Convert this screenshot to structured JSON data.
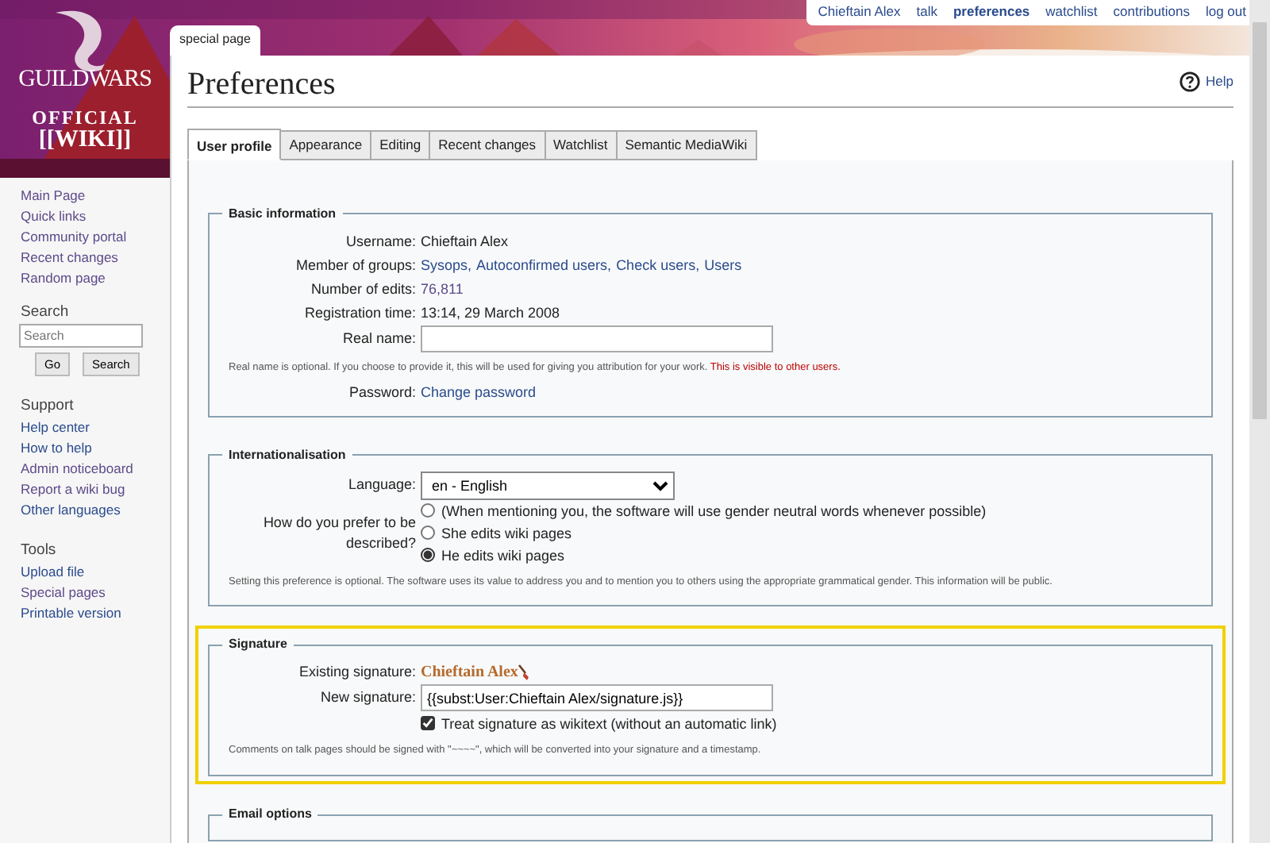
{
  "logo": {
    "lines": [
      "GUILDWARS",
      "OFFICIAL",
      "[[WIKI]]"
    ]
  },
  "personal_links": [
    {
      "label": "Chieftain Alex",
      "selected": false
    },
    {
      "label": "talk",
      "selected": false
    },
    {
      "label": "preferences",
      "selected": true
    },
    {
      "label": "watchlist",
      "selected": false
    },
    {
      "label": "contributions",
      "selected": false
    },
    {
      "label": "log out",
      "selected": false
    }
  ],
  "page_tab": "special page",
  "title": "Preferences",
  "help": "Help",
  "sidebar": {
    "navigation": [
      {
        "label": "Main Page",
        "visited": true
      },
      {
        "label": "Quick links",
        "visited": true
      },
      {
        "label": "Community portal",
        "visited": true
      },
      {
        "label": "Recent changes",
        "visited": true
      },
      {
        "label": "Random page",
        "visited": true
      }
    ],
    "search": {
      "heading": "Search",
      "placeholder": "Search",
      "buttons": [
        "Go",
        "Search"
      ]
    },
    "portals": [
      {
        "heading": "Support",
        "items": [
          {
            "label": "Help center",
            "visited": false
          },
          {
            "label": "How to help",
            "visited": false
          },
          {
            "label": "Admin noticeboard",
            "visited": true
          },
          {
            "label": "Report a wiki bug",
            "visited": true
          },
          {
            "label": "Other languages",
            "visited": false
          }
        ]
      },
      {
        "heading": "Tools",
        "items": [
          {
            "label": "Upload file",
            "visited": false
          },
          {
            "label": "Special pages",
            "visited": true
          },
          {
            "label": "Printable version",
            "visited": false
          }
        ]
      }
    ]
  },
  "tabs": [
    {
      "label": "User profile",
      "selected": true
    },
    {
      "label": "Appearance",
      "selected": false
    },
    {
      "label": "Editing",
      "selected": false
    },
    {
      "label": "Recent changes",
      "selected": false
    },
    {
      "label": "Watchlist",
      "selected": false
    },
    {
      "label": "Semantic MediaWiki",
      "selected": false
    }
  ],
  "sections": [
    {
      "legend": "Basic information",
      "highlighted": false,
      "rows": [
        {
          "kind": "text",
          "label": "Username:",
          "value": "Chieftain Alex"
        },
        {
          "kind": "links",
          "label": "Member of groups:",
          "links": [
            {
              "label": "Sysops,",
              "visited": false
            },
            {
              "label": "Autoconfirmed users,",
              "visited": false
            },
            {
              "label": "Check users,",
              "visited": false
            },
            {
              "label": "Users",
              "visited": false
            }
          ]
        },
        {
          "kind": "links",
          "label": "Number of edits:",
          "links": [
            {
              "label": "76,811",
              "visited": true
            }
          ]
        },
        {
          "kind": "text",
          "label": "Registration time:",
          "value": "13:14, 29 March 2008"
        },
        {
          "kind": "input",
          "label": "Real name:",
          "value": ""
        },
        {
          "kind": "help",
          "text": "Real name is optional. If you choose to provide it, this will be used for giving you attribution for your work.",
          "warning": "This is visible to other users."
        },
        {
          "kind": "links",
          "label": "Password:",
          "links": [
            {
              "label": "Change password",
              "visited": false
            }
          ]
        }
      ]
    },
    {
      "legend": "Internationalisation",
      "highlighted": false,
      "rows": [
        {
          "kind": "select",
          "label": "Language:",
          "value": "en - English"
        },
        {
          "kind": "radios",
          "label": "How do you prefer to be described?",
          "options": [
            {
              "label": "(When mentioning you, the software will use gender neutral words whenever possible)",
              "selected": false
            },
            {
              "label": "She edits wiki pages",
              "selected": false
            },
            {
              "label": "He edits wiki pages",
              "selected": true
            }
          ]
        },
        {
          "kind": "help",
          "text": "Setting this preference is optional. The software uses its value to address you and to mention you to others using the appropriate grammatical gender. This information will be public."
        }
      ]
    },
    {
      "legend": "Signature",
      "highlighted": true,
      "rows": [
        {
          "kind": "signature",
          "label": "Existing signature:",
          "value": "Chieftain Alex"
        },
        {
          "kind": "input",
          "label": "New signature:",
          "value": "{{subst:User:Chieftain Alex/signature.js}}"
        },
        {
          "kind": "checkbox",
          "label": "Treat signature as wikitext (without an automatic link)",
          "checked": true
        },
        {
          "kind": "help",
          "text": "Comments on talk pages should be signed with \"~~~~\", which will be converted into your signature and a timestamp."
        }
      ]
    },
    {
      "legend": "Email options",
      "highlighted": false
    }
  ]
}
